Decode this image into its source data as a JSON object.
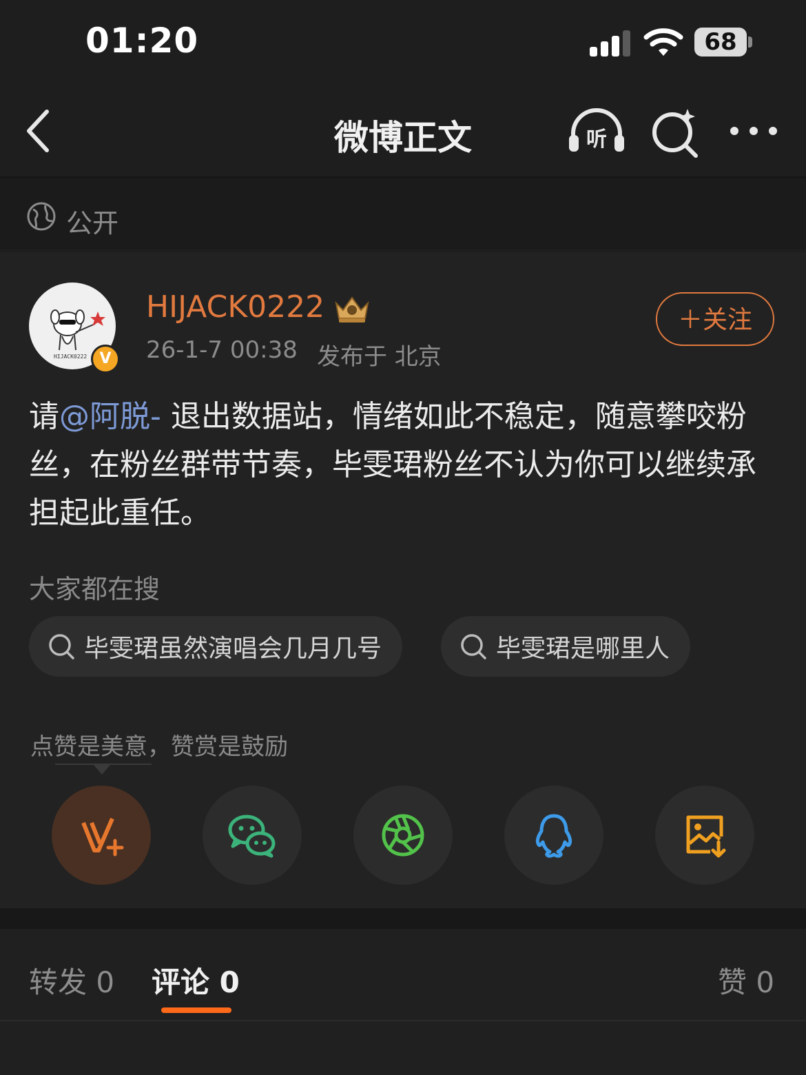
{
  "status_bar": {
    "time": "01:20",
    "battery": "68",
    "signal_bars": 3,
    "signal_max": 4
  },
  "nav": {
    "title": "微博正文",
    "listen_icon": "listen-headphones-icon",
    "search_icon": "sparkle-search-icon",
    "more_icon": "more-dots-icon"
  },
  "visibility": {
    "label": "公开",
    "icon": "globe-icon"
  },
  "post": {
    "author": {
      "username": "HIJACK0222",
      "verified": true,
      "verified_mark": "V",
      "badge_icon": "crown-badge-icon"
    },
    "time": "26-1-7 00:38",
    "location": "发布于 北京",
    "follow_label": "＋关注",
    "body": {
      "prefix": "请",
      "mention": "@阿脱-",
      "text": " 退出数据站，情绪如此不稳定，随意攀咬粉丝，在粉丝群带节奏，毕雯珺粉丝不认为你可以继续承担起此重任。"
    }
  },
  "trending": {
    "title": "大家都在搜",
    "queries": [
      "毕雯珺虽然演唱会几月几号",
      "毕雯珺是哪里人"
    ]
  },
  "reward": {
    "hint": "点赞是美意，赞赏是鼓励"
  },
  "share": {
    "buttons": [
      {
        "icon": "v-plus-icon",
        "color": "#e8772e"
      },
      {
        "icon": "wechat-icon",
        "color": "#3bb37a"
      },
      {
        "icon": "moments-icon",
        "color": "#52c24a"
      },
      {
        "icon": "qq-icon",
        "color": "#3d9be9"
      },
      {
        "icon": "save-image-icon",
        "color": "#f0a020"
      }
    ]
  },
  "tabs": {
    "repost": "转发 0",
    "comment": "评论 0",
    "like": "赞 0",
    "active": "comment"
  },
  "colors": {
    "accent": "#e27a3f",
    "indicator": "#ff6a1a",
    "mention": "#7d9ad6"
  }
}
